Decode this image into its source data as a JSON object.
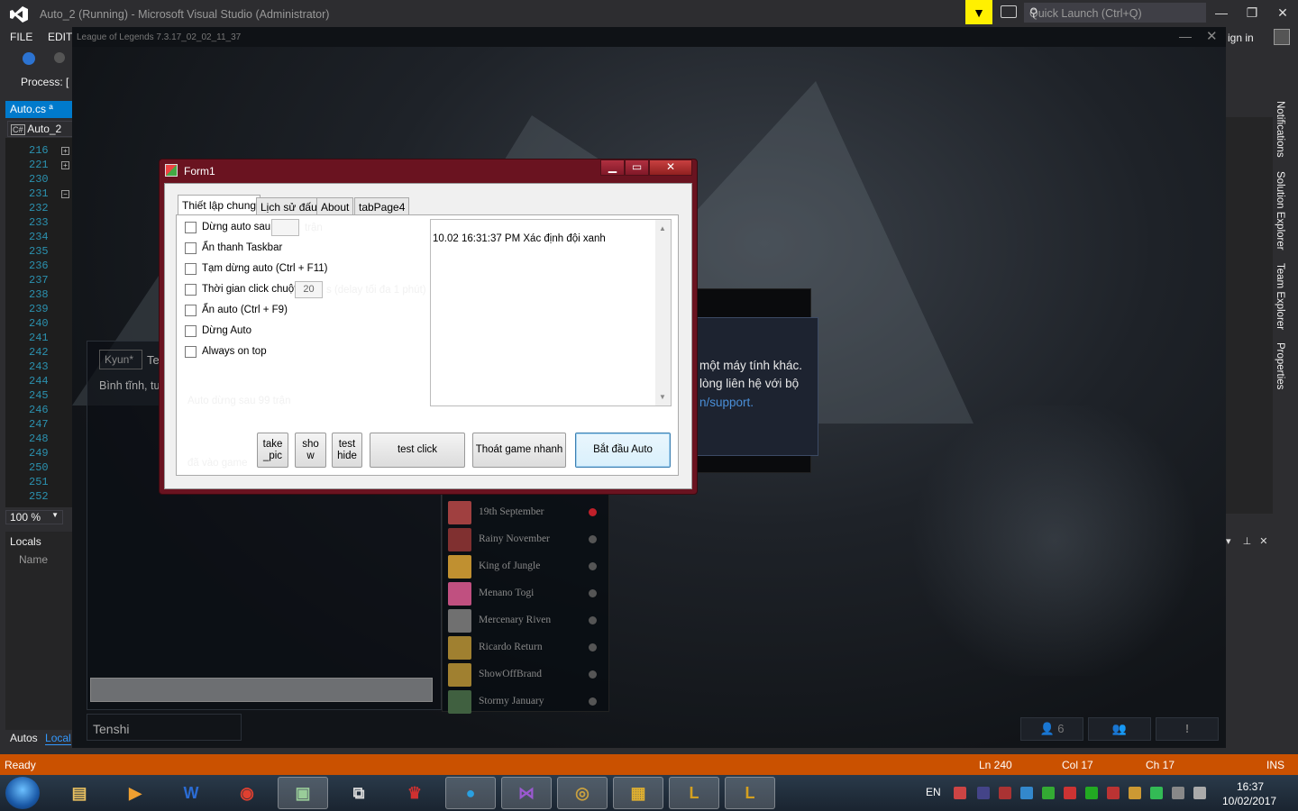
{
  "vs": {
    "title": "Auto_2 (Running) - Microsoft Visual Studio (Administrator)",
    "quick_launch_placeholder": "Quick Launch (Ctrl+Q)",
    "menu": [
      "FILE",
      "EDIT"
    ],
    "sign_in": "ign in",
    "process_label": "Process:",
    "process_value": "[",
    "doc_tab": "Auto.cs",
    "doc_tab_pin": "ª",
    "breadcrumb": "Auto_2",
    "line_numbers": [
      "216",
      "221",
      "230",
      "231",
      "232",
      "233",
      "234",
      "235",
      "236",
      "237",
      "238",
      "239",
      "240",
      "241",
      "242",
      "243",
      "244",
      "245",
      "246",
      "247",
      "248",
      "249",
      "250",
      "251",
      "252"
    ],
    "zoom": "100 %",
    "locals_title": "Locals",
    "locals_col": "Name",
    "bottom_tabs": [
      "Autos",
      "Local"
    ],
    "side_tabs": [
      "Notifications",
      "Solution Explorer",
      "Team Explorer",
      "Properties"
    ],
    "status": {
      "ready": "Ready",
      "ln": "Ln 240",
      "col": "Col 17",
      "ch": "Ch 17",
      "ins": "INS"
    },
    "accent_color": "#007acc",
    "status_color": "#ca5100"
  },
  "lol": {
    "title": "League of Legends 7.3.17_02_02_11_37",
    "dialog_line1": "một máy tính khác.",
    "dialog_line2": "lòng liên hệ với bộ",
    "dialog_link": "n/support.",
    "chat_tag": "Kyun*",
    "chat_te": "Te",
    "chat_status": "Bình tĩnh, tu",
    "summoner": "Tenshi",
    "friends": [
      {
        "name": "19th September",
        "status": "busy",
        "color": "#a04040"
      },
      {
        "name": "Rainy November",
        "status": "offline",
        "color": "#803030"
      },
      {
        "name": "King of Jungle",
        "status": "offline",
        "color": "#c09030"
      },
      {
        "name": "Menano Togi",
        "status": "offline",
        "color": "#c05080"
      },
      {
        "name": "Mercenary Riven",
        "status": "offline",
        "color": "#707070"
      },
      {
        "name": "Ricardo Return",
        "status": "offline",
        "color": "#a08030"
      },
      {
        "name": "ShowOffBrand",
        "status": "offline",
        "color": "#a08030"
      },
      {
        "name": "Stormy January",
        "status": "offline",
        "color": "#406040"
      }
    ],
    "friend_count": "6",
    "alert_glyph": "!"
  },
  "form1": {
    "title": "Form1",
    "tabs": [
      "Thiết lập chung",
      "Lịch sử đấu",
      "About",
      "tabPage4"
    ],
    "checkboxes": [
      "Dừng auto sau",
      "Ẩn thanh Taskbar",
      "Tạm dừng auto (Ctrl + F11)",
      "Thời gian click chuột",
      "Ẩn auto (Ctrl + F9)",
      "Dừng Auto",
      "Always on top"
    ],
    "label_tran": "trận",
    "click_delay_value": "20",
    "label_delay": "s (delay tối đa 1 phút)",
    "label_stop_after": "Auto dừng sau 99 trận",
    "label_entered": "đã vào game",
    "log_line": "10.02 16:31:37 PM Xác định đội xanh",
    "buttons": {
      "take_pic": [
        "take",
        "_pic"
      ],
      "show": [
        "sho",
        "w"
      ],
      "test_hide": [
        "test",
        "hide"
      ],
      "test_click": "test click",
      "quit_fast": "Thoát game nhanh",
      "start_auto": "Bắt đầu Auto"
    }
  },
  "taskbar": {
    "lang": "EN",
    "time": "16:37",
    "date": "10/02/2017"
  }
}
